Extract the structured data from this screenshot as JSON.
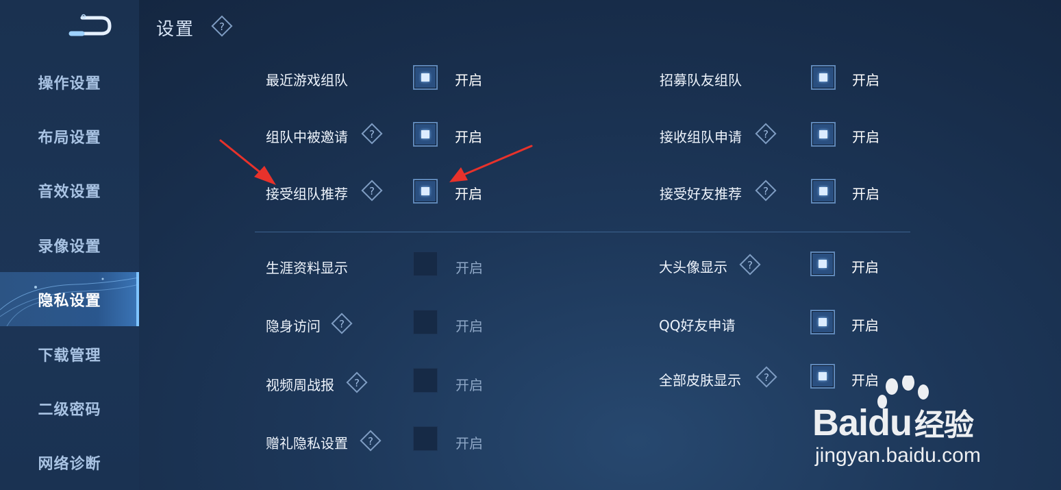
{
  "header": {
    "title": "设置"
  },
  "sidebar": {
    "items": [
      {
        "label": "操作设置",
        "active": false
      },
      {
        "label": "布局设置",
        "active": false
      },
      {
        "label": "音效设置",
        "active": false
      },
      {
        "label": "录像设置",
        "active": false
      },
      {
        "label": "隐私设置",
        "active": true
      },
      {
        "label": "下载管理",
        "active": false
      },
      {
        "label": "二级密码",
        "active": false
      },
      {
        "label": "网络诊断",
        "active": false
      }
    ]
  },
  "settings": {
    "left": [
      {
        "label": "最近游戏组队",
        "help": false,
        "checked": true,
        "state": "开启"
      },
      {
        "label": "组队中被邀请",
        "help": true,
        "checked": true,
        "state": "开启"
      },
      {
        "label": "接受组队推荐",
        "help": true,
        "checked": true,
        "state": "开启"
      },
      {
        "label": "生涯资料显示",
        "help": false,
        "checked": false,
        "state": "开启"
      },
      {
        "label": "隐身访问",
        "help": true,
        "checked": false,
        "state": "开启"
      },
      {
        "label": "视频周战报",
        "help": true,
        "checked": false,
        "state": "开启"
      },
      {
        "label": "赠礼隐私设置",
        "help": true,
        "checked": false,
        "state": "开启"
      }
    ],
    "right": [
      {
        "label": "招募队友组队",
        "help": false,
        "checked": true,
        "state": "开启"
      },
      {
        "label": "接收组队申请",
        "help": true,
        "checked": true,
        "state": "开启"
      },
      {
        "label": "接受好友推荐",
        "help": true,
        "checked": true,
        "state": "开启"
      },
      {
        "label": "大头像显示",
        "help": true,
        "checked": true,
        "state": "开启"
      },
      {
        "label": "QQ好友申请",
        "help": false,
        "checked": true,
        "state": "开启"
      },
      {
        "label": "全部皮肤显示",
        "help": true,
        "checked": true,
        "state": "开启"
      }
    ]
  },
  "watermark": {
    "brand": "Bai",
    "brand_du": "du",
    "brand_cn": "经验",
    "url": "jingyan.baidu.com"
  },
  "colors": {
    "accent": "#7fc4ff",
    "annotation_arrow": "#e8322b",
    "background": "#1d3759"
  }
}
